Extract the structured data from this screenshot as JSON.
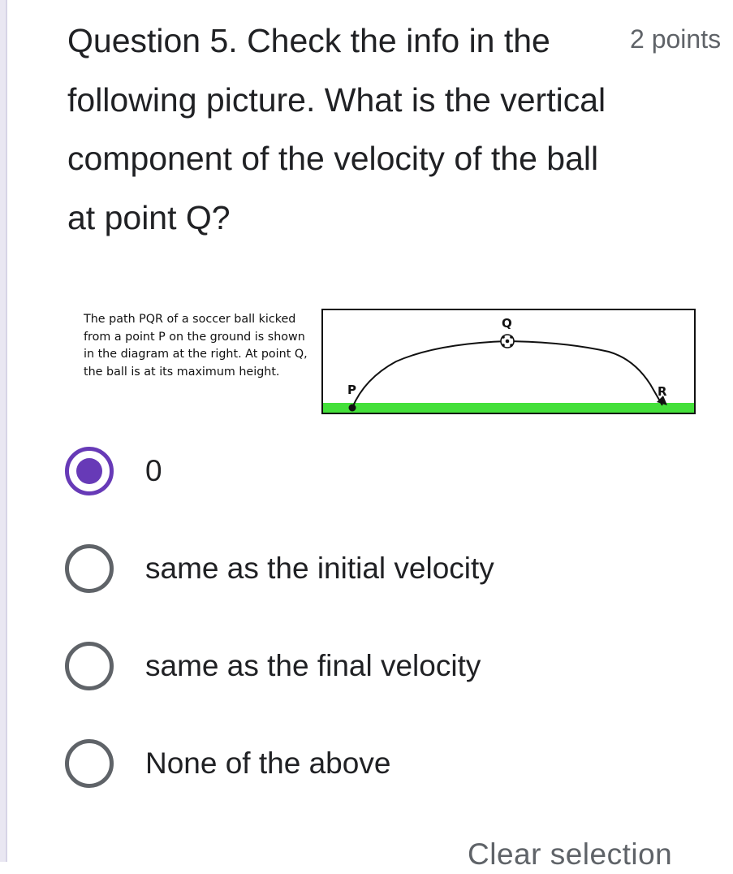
{
  "question": {
    "title": "Question 5. Check the info in the following picture. What is the vertical component of the velocity of the ball at point Q?",
    "points": "2 points"
  },
  "figure": {
    "caption": "The path PQR of a soccer ball kicked\nfrom a point P on the ground is shown\nin the diagram at the right. At point Q,\nthe ball is at its maximum height.",
    "label_p": "P",
    "label_q": "Q",
    "label_r": "R",
    "ground_color": "#44e03a",
    "ball_icon": "soccer-ball-icon"
  },
  "options": [
    {
      "label": "0",
      "checked": true
    },
    {
      "label": "same as the initial velocity",
      "checked": false
    },
    {
      "label": "same as the final velocity",
      "checked": false
    },
    {
      "label": "None of the above",
      "checked": false
    }
  ],
  "clear_selection": "Clear selection",
  "colors": {
    "accent": "#673ab7",
    "unchecked_radio": "#5f6368",
    "text": "#202124",
    "secondary_text": "#5f6368"
  }
}
